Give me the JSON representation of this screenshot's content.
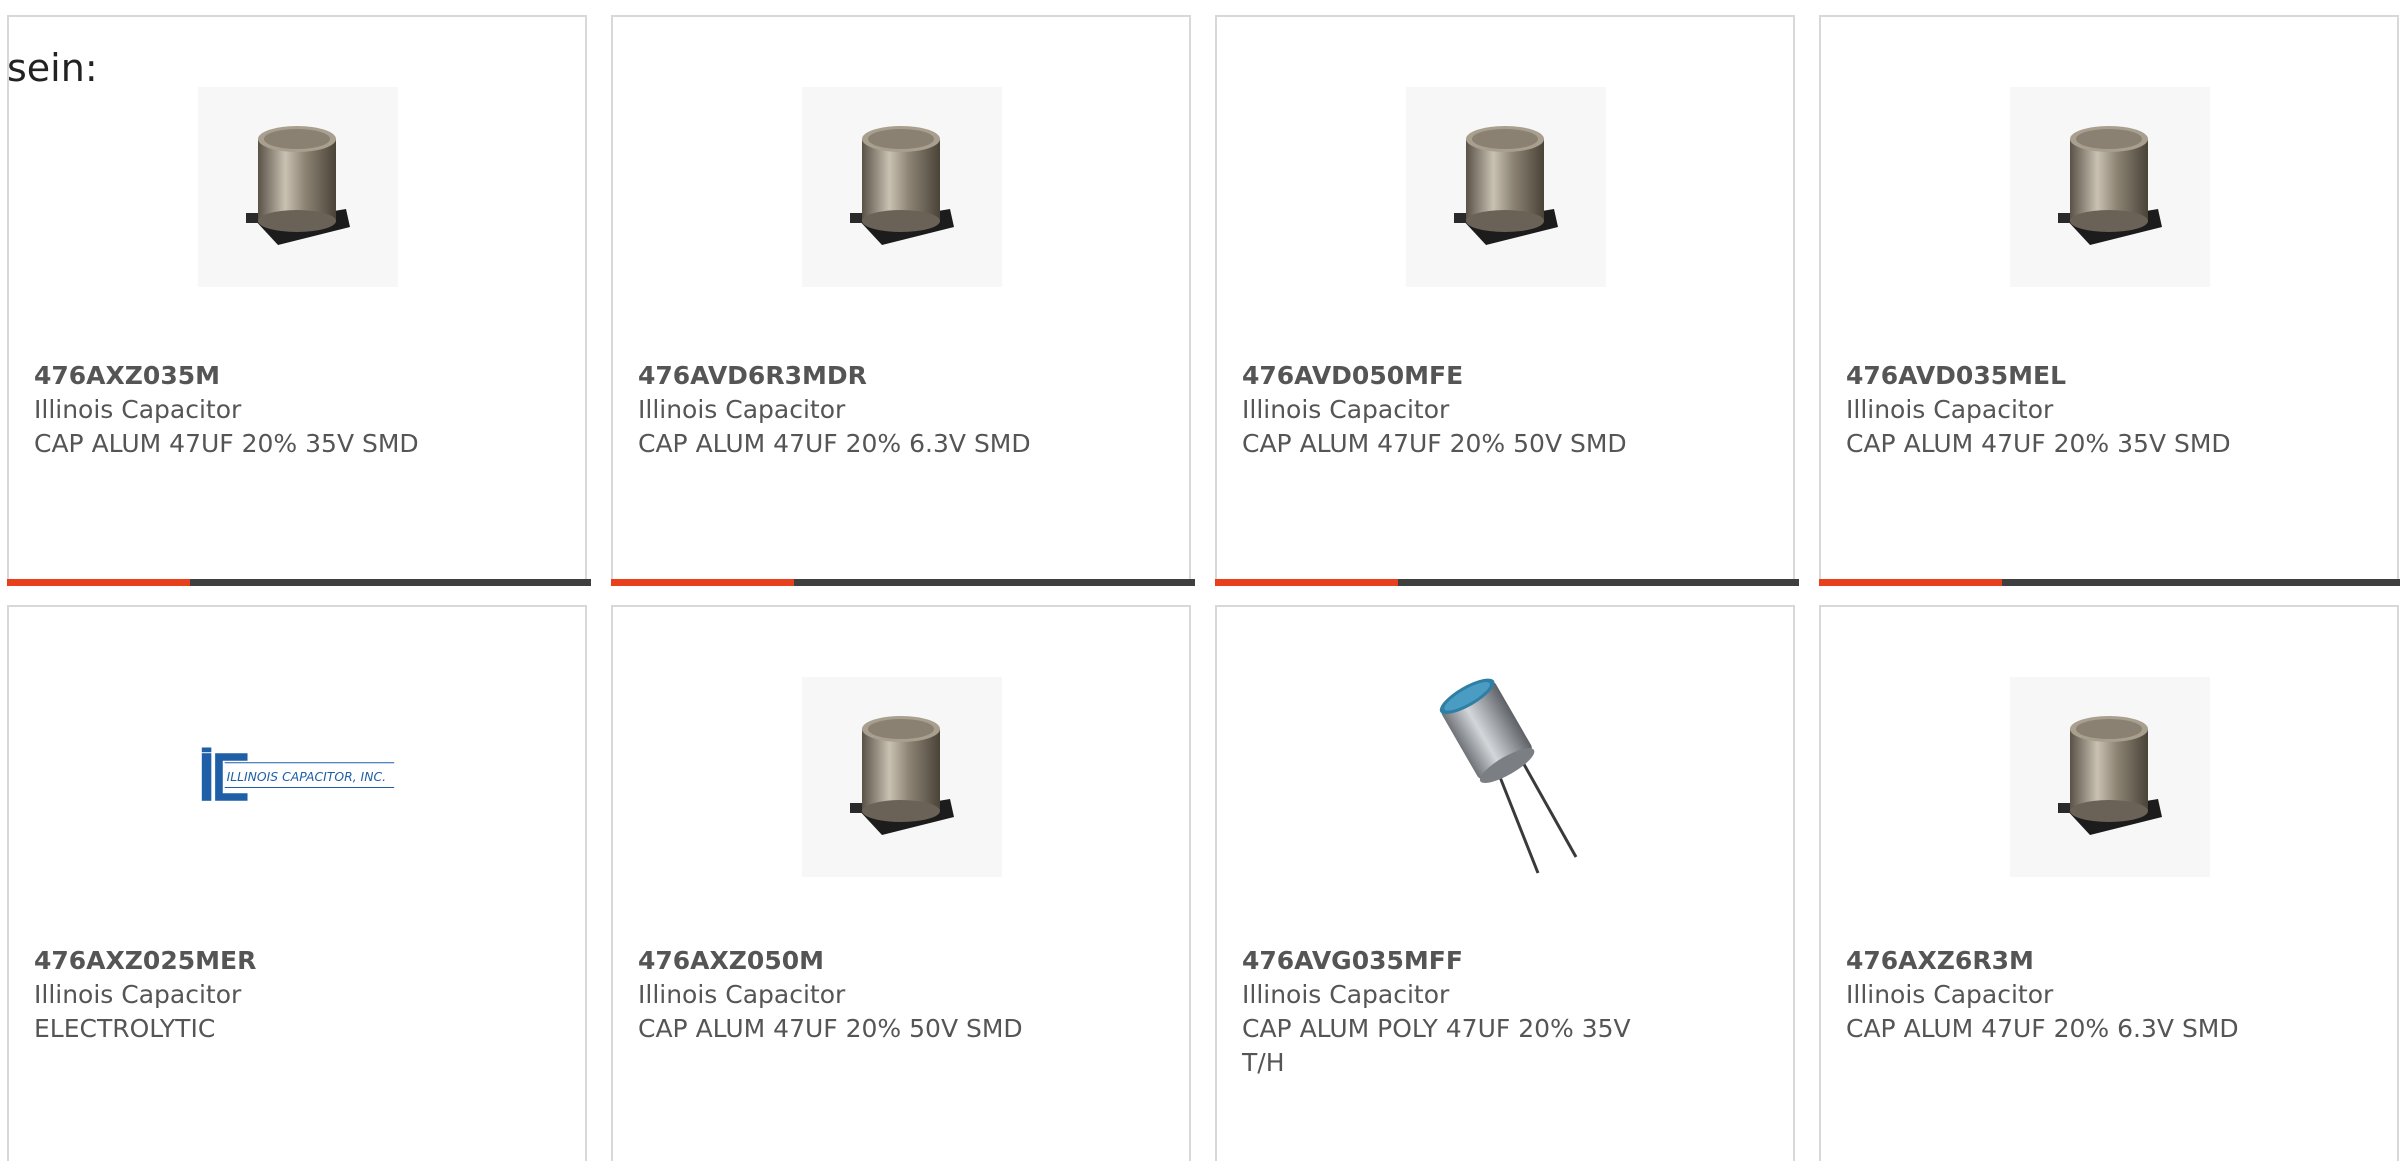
{
  "intro": {
    "text": "sein:"
  },
  "products": [
    {
      "part_number": "476AXZ035M",
      "manufacturer": "Illinois Capacitor",
      "description": "CAP ALUM 47UF 20% 35V SMD",
      "image": "smd-capacitor-icon"
    },
    {
      "part_number": "476AVD6R3MDR",
      "manufacturer": "Illinois Capacitor",
      "description": "CAP ALUM 47UF 20% 6.3V SMD",
      "image": "smd-capacitor-icon"
    },
    {
      "part_number": "476AVD050MFE",
      "manufacturer": "Illinois Capacitor",
      "description": "CAP ALUM 47UF 20% 50V SMD",
      "image": "smd-capacitor-icon"
    },
    {
      "part_number": "476AVD035MEL",
      "manufacturer": "Illinois Capacitor",
      "description": "CAP ALUM 47UF 20% 35V SMD",
      "image": "smd-capacitor-icon"
    },
    {
      "part_number": "476AXZ025MER",
      "manufacturer": "Illinois Capacitor",
      "description": "ELECTROLYTIC",
      "image": "manufacturer-logo",
      "logo_text": "ILLINOIS CAPACITOR, INC."
    },
    {
      "part_number": "476AXZ050M",
      "manufacturer": "Illinois Capacitor",
      "description": "CAP ALUM 47UF 20% 50V SMD",
      "image": "smd-capacitor-icon"
    },
    {
      "part_number": "476AVG035MFF",
      "manufacturer": "Illinois Capacitor",
      "description": "CAP ALUM POLY 47UF 20% 35V T/H",
      "image": "through-hole-capacitor-icon"
    },
    {
      "part_number": "476AXZ6R3M",
      "manufacturer": "Illinois Capacitor",
      "description": "CAP ALUM 47UF 20% 6.3V SMD",
      "image": "smd-capacitor-icon"
    }
  ],
  "colors": {
    "accent": "#e8401c",
    "bar": "#3f3f3f",
    "border": "#d8d8d8",
    "text": "#555555",
    "logo": "#1f5fa8"
  }
}
